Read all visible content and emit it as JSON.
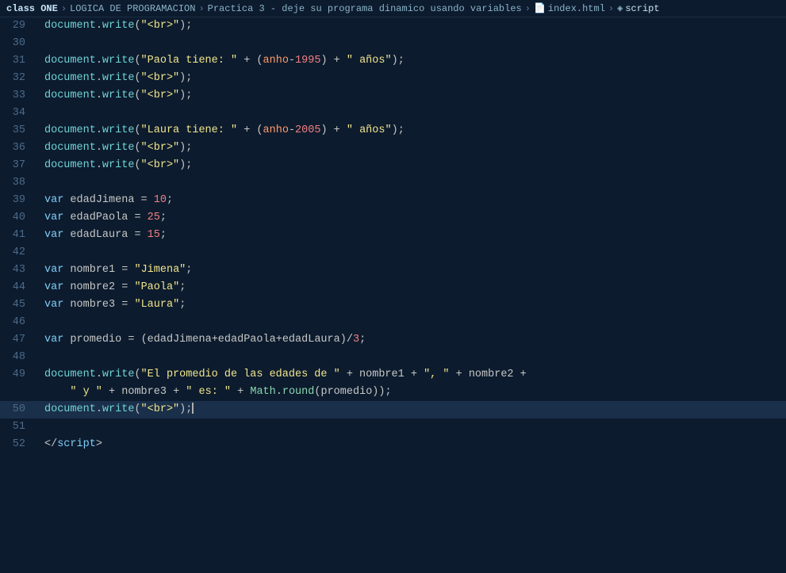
{
  "breadcrumb": {
    "home": "class ONE",
    "sep1": ">",
    "item1": "LOGICA DE PROGRAMACION",
    "sep2": ">",
    "item2": "Practica 3 - deje su programa dinamico usando variables",
    "sep3": ">",
    "file_icon": "📄",
    "file": "index.html",
    "sep4": ">",
    "script_icon": "◈",
    "script": "script"
  },
  "lines": [
    {
      "num": 29,
      "highlighted": false
    },
    {
      "num": 30,
      "highlighted": false
    },
    {
      "num": 31,
      "highlighted": false
    },
    {
      "num": 32,
      "highlighted": false
    },
    {
      "num": 33,
      "highlighted": false
    },
    {
      "num": 34,
      "highlighted": false
    },
    {
      "num": 35,
      "highlighted": false
    },
    {
      "num": 36,
      "highlighted": false
    },
    {
      "num": 37,
      "highlighted": false
    },
    {
      "num": 38,
      "highlighted": false
    },
    {
      "num": 39,
      "highlighted": false
    },
    {
      "num": 40,
      "highlighted": false
    },
    {
      "num": 41,
      "highlighted": false
    },
    {
      "num": 42,
      "highlighted": false
    },
    {
      "num": 43,
      "highlighted": false
    },
    {
      "num": 44,
      "highlighted": false
    },
    {
      "num": 45,
      "highlighted": false
    },
    {
      "num": 46,
      "highlighted": false
    },
    {
      "num": 47,
      "highlighted": false
    },
    {
      "num": 48,
      "highlighted": false
    },
    {
      "num": 49,
      "highlighted": false
    },
    {
      "num": 50,
      "highlighted": true
    },
    {
      "num": 51,
      "highlighted": false
    },
    {
      "num": 52,
      "highlighted": false
    }
  ]
}
